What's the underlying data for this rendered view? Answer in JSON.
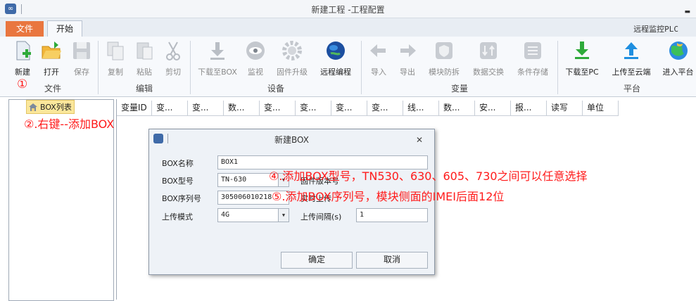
{
  "window": {
    "title": "新建工程 -工程配置"
  },
  "tabs": {
    "file": "文件",
    "start": "开始"
  },
  "remote_monitor": "远程监控PLC",
  "ribbon": {
    "buttons": [
      {
        "label": "新建",
        "icon": "new-file-icon"
      },
      {
        "label": "打开",
        "icon": "open-folder-icon"
      },
      {
        "label": "保存",
        "icon": "save-icon"
      },
      {
        "label": "复制",
        "icon": "copy-icon"
      },
      {
        "label": "粘贴",
        "icon": "paste-icon"
      },
      {
        "label": "剪切",
        "icon": "cut-icon"
      },
      {
        "label": "下载至BOX",
        "icon": "download-icon"
      },
      {
        "label": "监视",
        "icon": "eye-icon"
      },
      {
        "label": "固件升级",
        "icon": "gear-icon"
      },
      {
        "label": "远程编程",
        "icon": "globe-icon"
      },
      {
        "label": "导入",
        "icon": "import-icon"
      },
      {
        "label": "导出",
        "icon": "export-icon"
      },
      {
        "label": "模块防拆",
        "icon": "shield-icon"
      },
      {
        "label": "数据交换",
        "icon": "exchange-icon"
      },
      {
        "label": "条件存储",
        "icon": "list-icon"
      },
      {
        "label": "下载至PC",
        "icon": "download-pc-icon"
      },
      {
        "label": "上传至云端",
        "icon": "upload-cloud-icon"
      },
      {
        "label": "进入平台",
        "icon": "platform-icon"
      }
    ],
    "groups": {
      "file": "文件",
      "edit": "编辑",
      "device": "设备",
      "variable": "变量",
      "platform": "平台"
    }
  },
  "tree": {
    "item": "BOX列表"
  },
  "grid": {
    "columns": [
      "变量ID",
      "变...",
      "变...",
      "数...",
      "变...",
      "变...",
      "变...",
      "变...",
      "线...",
      "数...",
      "安...",
      "报...",
      "读写",
      "单位"
    ]
  },
  "annotations": {
    "a1": "①",
    "a2": "②.右键--添加BOX",
    "a4": "④.添加BOX型号，TN530、630、605、730之间可以任意选择",
    "a5": "⑤.添加BOX序列号，模块侧面的IMEI后面12位"
  },
  "dialog": {
    "title": "新建BOX",
    "name_label": "BOX名称",
    "name_value": "BOX1",
    "model_label": "BOX型号",
    "model_value": "TN-630",
    "firmware_label": "固件版本号",
    "serial_label": "BOX序列号",
    "serial_value": "305006010218",
    "realtime_label": "实时上传",
    "upload_mode_label": "上传模式",
    "upload_mode_value": "4G",
    "upload_interval_label": "上传间隔(s)",
    "upload_interval_value": "1",
    "ok": "确定",
    "cancel": "取消"
  }
}
